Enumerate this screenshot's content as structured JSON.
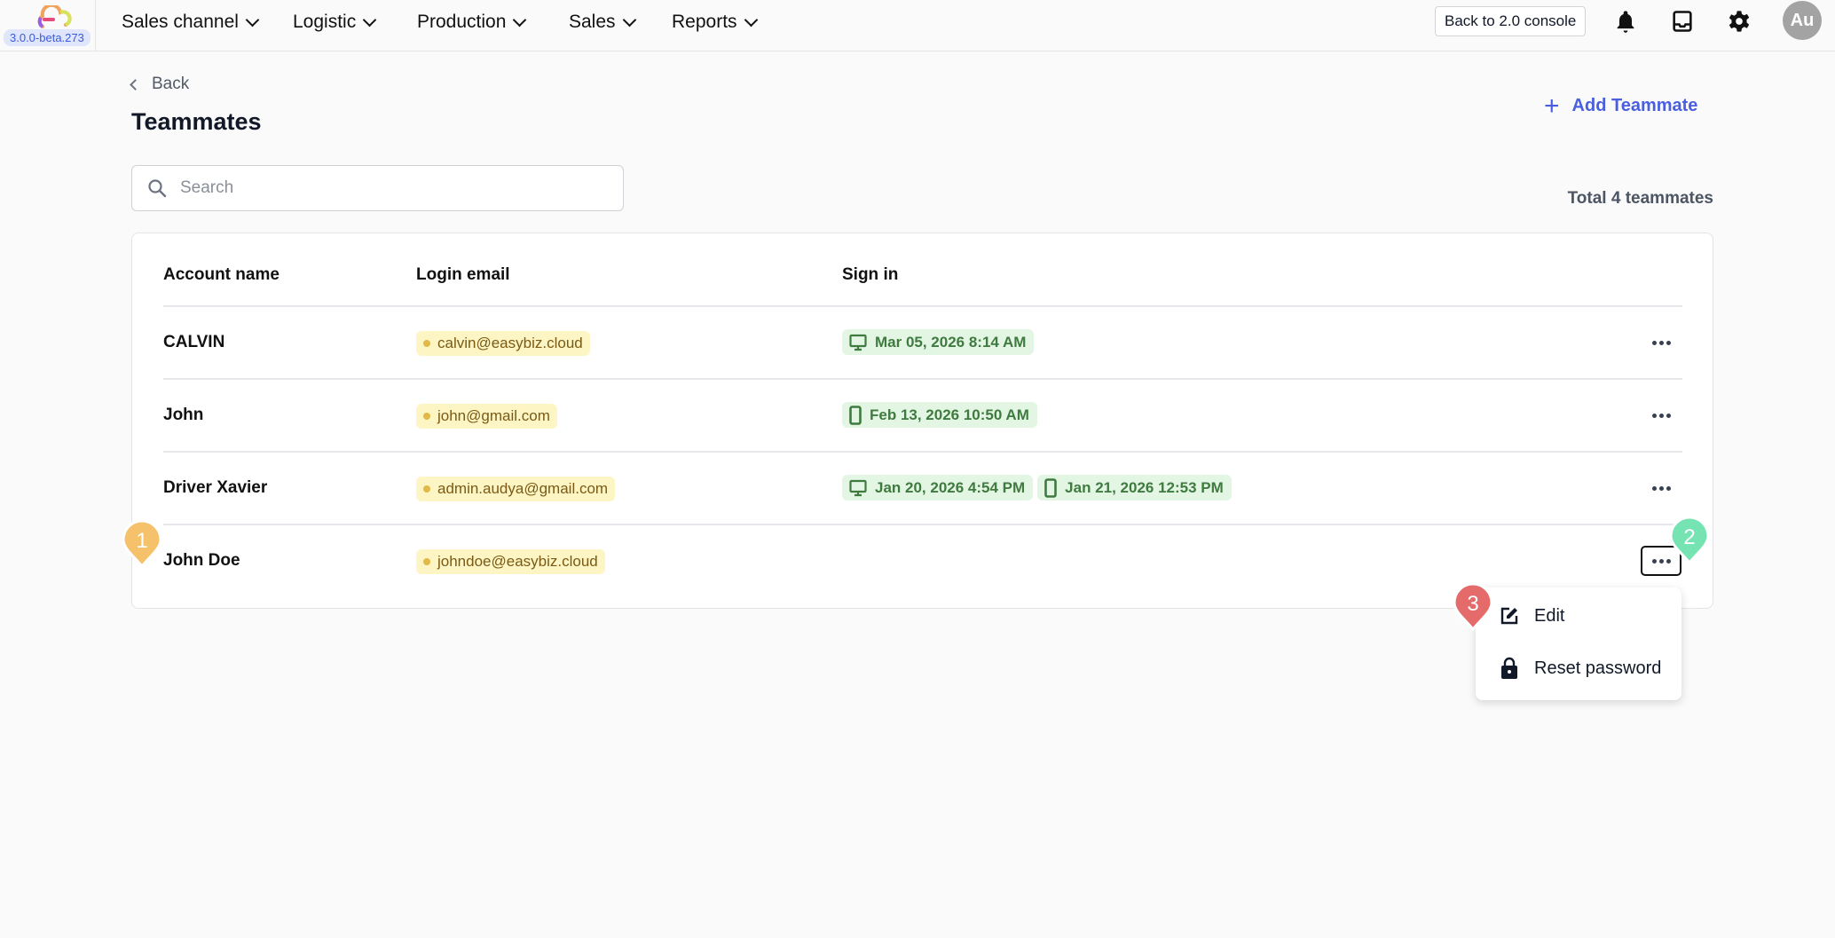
{
  "app": {
    "version": "3.0.0-beta.273"
  },
  "nav": [
    {
      "label": "Sales channel"
    },
    {
      "label": "Logistic"
    },
    {
      "label": "Production"
    },
    {
      "label": "Sales"
    },
    {
      "label": "Reports"
    }
  ],
  "topbar": {
    "back_console": "Back to 2.0 console",
    "avatar": "Au"
  },
  "page": {
    "back": "Back",
    "title": "Teammates",
    "add_label": "Add Teammate",
    "search_placeholder": "Search",
    "total": "Total 4 teammates"
  },
  "table": {
    "headers": [
      "Account name",
      "Login email",
      "Sign in"
    ],
    "rows": [
      {
        "name": "CALVIN",
        "email": "calvin@easybiz.cloud",
        "signins": [
          {
            "device": "desktop",
            "time": "Mar 05, 2026 8:14 AM"
          }
        ]
      },
      {
        "name": "John",
        "email": "john@gmail.com",
        "signins": [
          {
            "device": "mobile",
            "time": "Feb 13, 2026 10:50 AM"
          }
        ]
      },
      {
        "name": "Driver Xavier",
        "email": "admin.audya@gmail.com",
        "signins": [
          {
            "device": "desktop",
            "time": "Jan 20, 2026 4:54 PM"
          },
          {
            "device": "mobile",
            "time": "Jan 21, 2026 12:53 PM"
          }
        ]
      },
      {
        "name": "John Doe",
        "email": "johndoe@easybiz.cloud",
        "signins": []
      }
    ]
  },
  "menu": {
    "items": [
      {
        "label": "Edit",
        "icon": "edit-icon"
      },
      {
        "label": "Reset password",
        "icon": "lock-icon"
      }
    ]
  },
  "markers": [
    {
      "label": "1",
      "color": "#f5c26b"
    },
    {
      "label": "2",
      "color": "#76e3b3"
    },
    {
      "label": "3",
      "color": "#e56b6b"
    }
  ]
}
